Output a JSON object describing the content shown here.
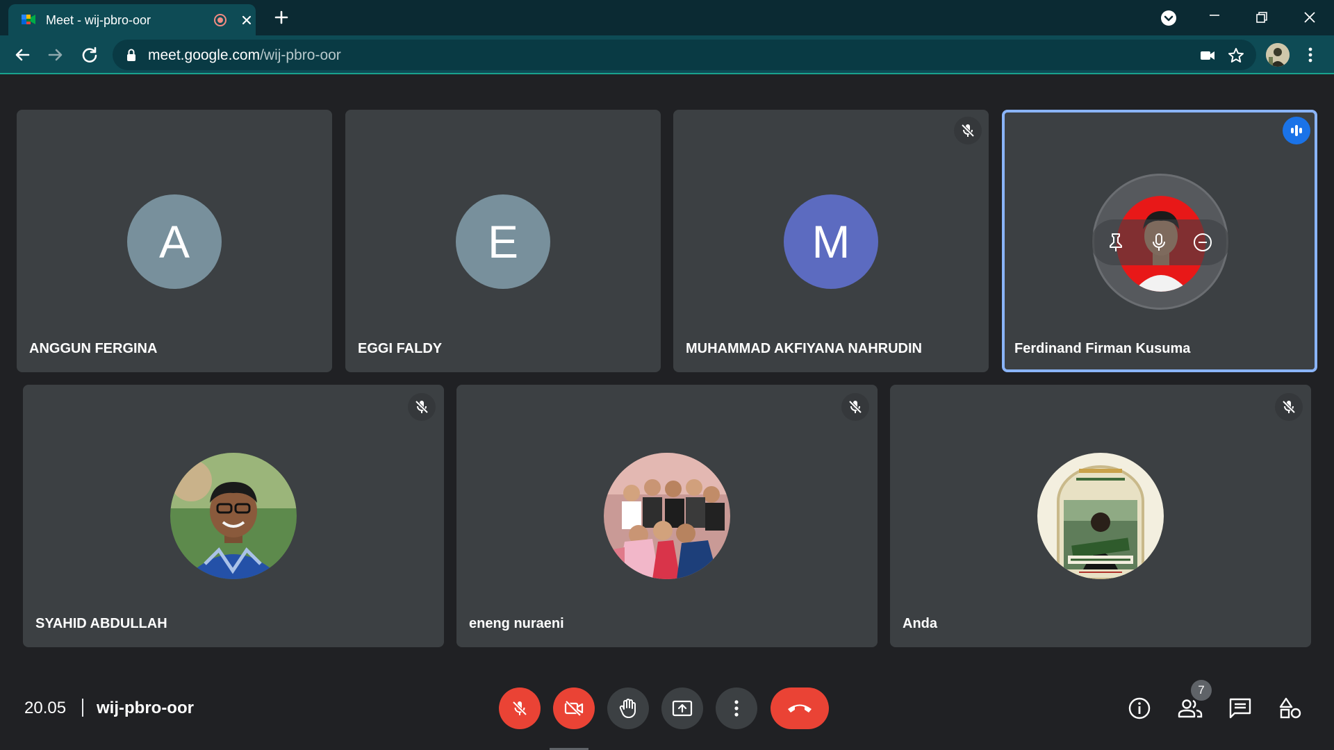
{
  "browser": {
    "tab_title": "Meet - wij-pbro-oor",
    "url_host": "meet.google.com",
    "url_path": "/wij-pbro-oor",
    "icons": {
      "favicon": "google-meet-icon",
      "record": "recording-icon",
      "close": "close-icon",
      "new_tab": "plus-icon",
      "back": "back-arrow-icon",
      "forward": "forward-arrow-icon",
      "reload": "reload-icon",
      "lock": "lock-icon",
      "camera": "camera-icon",
      "bookmark": "star-icon",
      "menu": "more-vert-icon"
    }
  },
  "participants": [
    {
      "name": "ANGGUN FERGINA",
      "initial": "A",
      "avatar_color": "#78909c",
      "muted": false
    },
    {
      "name": "EGGI FALDY",
      "initial": "E",
      "avatar_color": "#78909c",
      "muted": false
    },
    {
      "name": "MUHAMMAD AKFIYANA NAHRUDIN",
      "initial": "M",
      "avatar_color": "#5c6bc0",
      "muted": true
    },
    {
      "name": "Ferdinand Firman Kusuma",
      "speaking": true,
      "photo": true
    },
    {
      "name": "SYAHID ABDULLAH",
      "muted": true,
      "photo": true
    },
    {
      "name": "eneng nuraeni",
      "muted": true,
      "photo": true
    },
    {
      "name": "Anda",
      "muted": true,
      "photo": true
    }
  ],
  "meeting": {
    "time": "20.05",
    "code": "wij-pbro-oor",
    "people_count": "7"
  },
  "colors": {
    "tile_bg": "#3c4043",
    "active_border": "#8ab4f8",
    "danger": "#ea4335",
    "speaking": "#1a73e8"
  }
}
